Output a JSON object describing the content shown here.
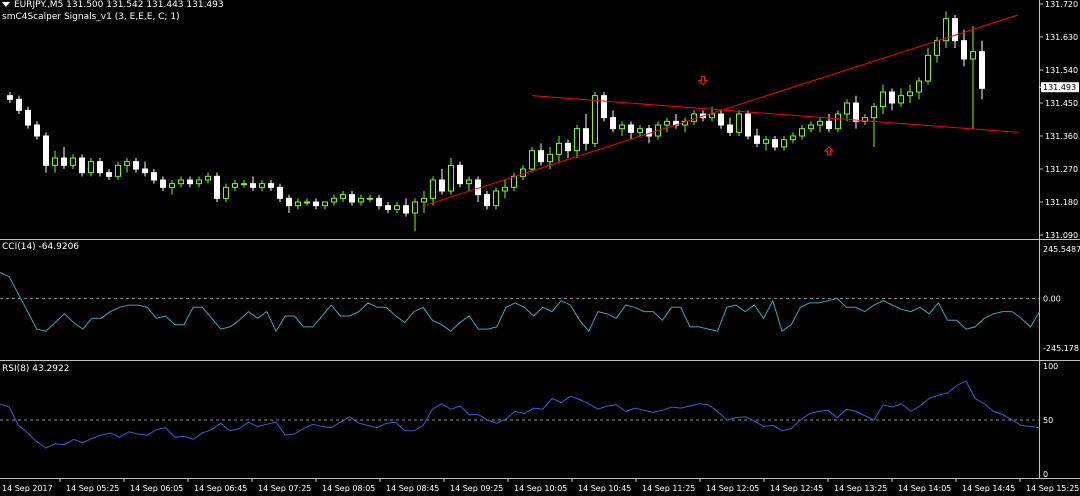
{
  "header": {
    "symbol_line": "EURJPY.,M5  131.500 131.542 131.443 131.493",
    "indicator_line": "smC4Scalper Signals_v1 (3, E,E,E, C; 1)"
  },
  "cci_panel": {
    "label": "CCI(14) -64.9206",
    "ticks": [
      "245.5487",
      "0.00",
      "-245.178"
    ]
  },
  "rsi_panel": {
    "label": "RSI(8) 43.2922",
    "ticks": [
      "100",
      "50",
      "0"
    ]
  },
  "price_axis": {
    "ticks": [
      "131.720",
      "131.630",
      "131.540",
      "131.450",
      "131.360",
      "131.270",
      "131.180",
      "131.090"
    ],
    "current_price_label": "131.493"
  },
  "time_axis": {
    "labels": [
      "14 Sep 2017",
      "14 Sep 05:25",
      "14 Sep 06:05",
      "14 Sep 06:45",
      "14 Sep 07:25",
      "14 Sep 08:05",
      "14 Sep 08:45",
      "14 Sep 09:25",
      "14 Sep 10:05",
      "14 Sep 10:45",
      "14 Sep 11:25",
      "14 Sep 12:05",
      "14 Sep 12:45",
      "14 Sep 13:25",
      "14 Sep 14:05",
      "14 Sep 14:45",
      "14 Sep 15:25"
    ]
  },
  "colors": {
    "background": "#000000",
    "bull": "#7cfc00",
    "bear": "#ffffff",
    "candle_body": "#ffffff",
    "trendline": "#ff0000",
    "arrow": "#ff2020",
    "cci": "#3aa7b5",
    "rsi": "#3a5bd9",
    "axis_text": "#ffffff",
    "separator": "#c0c0c0",
    "current_price_bg": "#ffffff"
  },
  "chart_data": [
    {
      "type": "candlestick",
      "title": "EURJPY.,M5",
      "ylim": [
        131.09,
        131.72
      ],
      "candles": [
        [
          131.47,
          131.48,
          131.45,
          131.46
        ],
        [
          131.46,
          131.47,
          131.42,
          131.43
        ],
        [
          131.43,
          131.44,
          131.38,
          131.39
        ],
        [
          131.39,
          131.4,
          131.35,
          131.36
        ],
        [
          131.36,
          131.37,
          131.26,
          131.28
        ],
        [
          131.28,
          131.32,
          131.26,
          131.3
        ],
        [
          131.3,
          131.33,
          131.27,
          131.28
        ],
        [
          131.28,
          131.31,
          131.27,
          131.3
        ],
        [
          131.3,
          131.31,
          131.25,
          131.26
        ],
        [
          131.26,
          131.3,
          131.25,
          131.29
        ],
        [
          131.29,
          131.3,
          131.25,
          131.26
        ],
        [
          131.26,
          131.27,
          131.24,
          131.25
        ],
        [
          131.25,
          131.29,
          131.24,
          131.28
        ],
        [
          131.28,
          131.3,
          131.26,
          131.29
        ],
        [
          131.29,
          131.3,
          131.26,
          131.27
        ],
        [
          131.27,
          131.29,
          131.25,
          131.26
        ],
        [
          131.26,
          131.27,
          131.23,
          131.24
        ],
        [
          131.24,
          131.25,
          131.21,
          131.22
        ],
        [
          131.22,
          131.24,
          131.2,
          131.23
        ],
        [
          131.23,
          131.25,
          131.22,
          131.24
        ],
        [
          131.24,
          131.25,
          131.22,
          131.23
        ],
        [
          131.23,
          131.25,
          131.22,
          131.24
        ],
        [
          131.24,
          131.26,
          131.23,
          131.25
        ],
        [
          131.25,
          131.26,
          131.18,
          131.19
        ],
        [
          131.19,
          131.23,
          131.18,
          131.22
        ],
        [
          131.22,
          131.24,
          131.21,
          131.23
        ],
        [
          131.23,
          131.24,
          131.22,
          131.23
        ],
        [
          131.23,
          131.25,
          131.21,
          131.22
        ],
        [
          131.22,
          131.24,
          131.21,
          131.23
        ],
        [
          131.23,
          131.24,
          131.21,
          131.22
        ],
        [
          131.22,
          131.23,
          131.18,
          131.19
        ],
        [
          131.19,
          131.2,
          131.15,
          131.17
        ],
        [
          131.17,
          131.19,
          131.16,
          131.18
        ],
        [
          131.18,
          131.19,
          131.17,
          131.18
        ],
        [
          131.18,
          131.19,
          131.16,
          131.17
        ],
        [
          131.17,
          131.18,
          131.16,
          131.18
        ],
        [
          131.18,
          131.2,
          131.17,
          131.19
        ],
        [
          131.19,
          131.21,
          131.18,
          131.2
        ],
        [
          131.2,
          131.21,
          131.17,
          131.18
        ],
        [
          131.18,
          131.2,
          131.17,
          131.19
        ],
        [
          131.19,
          131.2,
          131.18,
          131.19
        ],
        [
          131.19,
          131.2,
          131.16,
          131.17
        ],
        [
          131.17,
          131.18,
          131.15,
          131.16
        ],
        [
          131.16,
          131.18,
          131.15,
          131.17
        ],
        [
          131.17,
          131.19,
          131.14,
          131.15
        ],
        [
          131.15,
          131.19,
          131.1,
          131.18
        ],
        [
          131.18,
          131.21,
          131.15,
          131.19
        ],
        [
          131.19,
          131.25,
          131.17,
          131.24
        ],
        [
          131.24,
          131.27,
          131.2,
          131.21
        ],
        [
          131.21,
          131.3,
          131.2,
          131.28
        ],
        [
          131.28,
          131.29,
          131.22,
          131.23
        ],
        [
          131.23,
          131.25,
          131.21,
          131.24
        ],
        [
          131.24,
          131.25,
          131.18,
          131.2
        ],
        [
          131.2,
          131.21,
          131.16,
          131.17
        ],
        [
          131.17,
          131.22,
          131.16,
          131.21
        ],
        [
          131.21,
          131.24,
          131.19,
          131.22
        ],
        [
          131.22,
          131.26,
          131.21,
          131.25
        ],
        [
          131.25,
          131.28,
          131.24,
          131.27
        ],
        [
          131.27,
          131.33,
          131.26,
          131.32
        ],
        [
          131.32,
          131.34,
          131.28,
          131.29
        ],
        [
          131.29,
          131.33,
          131.27,
          131.31
        ],
        [
          131.31,
          131.36,
          131.29,
          131.34
        ],
        [
          131.34,
          131.35,
          131.3,
          131.32
        ],
        [
          131.32,
          131.39,
          131.3,
          131.38
        ],
        [
          131.38,
          131.42,
          131.32,
          131.34
        ],
        [
          131.34,
          131.48,
          131.33,
          131.47
        ],
        [
          131.47,
          131.48,
          131.4,
          131.41
        ],
        [
          131.41,
          131.43,
          131.37,
          131.38
        ],
        [
          131.38,
          131.4,
          131.36,
          131.39
        ],
        [
          131.39,
          131.4,
          131.35,
          131.37
        ],
        [
          131.37,
          131.39,
          131.36,
          131.38
        ],
        [
          131.38,
          131.39,
          131.34,
          131.36
        ],
        [
          131.36,
          131.4,
          131.35,
          131.39
        ],
        [
          131.39,
          131.41,
          131.37,
          131.4
        ],
        [
          131.4,
          131.42,
          131.38,
          131.39
        ],
        [
          131.39,
          131.41,
          131.37,
          131.4
        ],
        [
          131.4,
          131.43,
          131.39,
          131.42
        ],
        [
          131.42,
          131.43,
          131.4,
          131.41
        ],
        [
          131.41,
          131.44,
          131.4,
          131.42
        ],
        [
          131.42,
          131.43,
          131.38,
          131.39
        ],
        [
          131.39,
          131.41,
          131.36,
          131.37
        ],
        [
          131.37,
          131.43,
          131.36,
          131.42
        ],
        [
          131.42,
          131.43,
          131.35,
          131.36
        ],
        [
          131.36,
          131.38,
          131.33,
          131.34
        ],
        [
          131.34,
          131.36,
          131.32,
          131.35
        ],
        [
          131.35,
          131.36,
          131.32,
          131.33
        ],
        [
          131.33,
          131.36,
          131.32,
          131.35
        ],
        [
          131.35,
          131.37,
          131.34,
          131.36
        ],
        [
          131.36,
          131.39,
          131.35,
          131.38
        ],
        [
          131.38,
          131.4,
          131.37,
          131.39
        ],
        [
          131.39,
          131.41,
          131.37,
          131.4
        ],
        [
          131.4,
          131.42,
          131.37,
          131.38
        ],
        [
          131.38,
          131.43,
          131.37,
          131.42
        ],
        [
          131.42,
          131.46,
          131.4,
          131.45
        ],
        [
          131.45,
          131.47,
          131.38,
          131.4
        ],
        [
          131.4,
          131.42,
          131.39,
          131.41
        ],
        [
          131.41,
          131.45,
          131.33,
          131.44
        ],
        [
          131.44,
          131.5,
          131.42,
          131.48
        ],
        [
          131.48,
          131.49,
          131.43,
          131.45
        ],
        [
          131.45,
          131.49,
          131.44,
          131.47
        ],
        [
          131.47,
          131.5,
          131.45,
          131.48
        ],
        [
          131.48,
          131.52,
          131.46,
          131.51
        ],
        [
          131.51,
          131.6,
          131.5,
          131.58
        ],
        [
          131.58,
          131.63,
          131.56,
          131.62
        ],
        [
          131.62,
          131.7,
          131.6,
          131.68
        ],
        [
          131.68,
          131.69,
          131.6,
          131.62
        ],
        [
          131.62,
          131.65,
          131.55,
          131.57
        ],
        [
          131.57,
          131.66,
          131.38,
          131.59
        ],
        [
          131.59,
          131.62,
          131.46,
          131.49
        ]
      ],
      "trendlines": [
        {
          "from": [
            131.47,
            58
          ],
          "to": [
            131.37,
            112
          ]
        },
        {
          "from": [
            131.17,
            46
          ],
          "to": [
            131.69,
            112
          ]
        }
      ],
      "signals": [
        {
          "type": "down",
          "index": 77,
          "price": 131.5
        },
        {
          "type": "up",
          "index": 91,
          "price": 131.33
        }
      ],
      "current_price": 131.493
    },
    {
      "type": "line",
      "title": "CCI(14) -64.9206",
      "ylim": [
        -245.178,
        245.5487
      ],
      "series": [
        {
          "name": "CCI(14)",
          "values": [
            120,
            100,
            20,
            -60,
            -140,
            -150,
            -110,
            -70,
            -110,
            -140,
            -90,
            -90,
            -60,
            -40,
            -30,
            -30,
            -40,
            -90,
            -80,
            -120,
            -120,
            -40,
            -40,
            -90,
            -140,
            -130,
            -100,
            -60,
            -90,
            -60,
            -150,
            -80,
            -80,
            -130,
            -130,
            -80,
            -30,
            -80,
            -80,
            -60,
            -20,
            -40,
            -40,
            -80,
            -110,
            -60,
            -40,
            -100,
            -120,
            -150,
            -110,
            -80,
            -140,
            -140,
            -130,
            -40,
            -20,
            -40,
            -80,
            -40,
            -60,
            -10,
            -30,
            -100,
            -150,
            -60,
            -70,
            -90,
            -30,
            -40,
            -60,
            -60,
            -100,
            -40,
            -40,
            -130,
            -130,
            -140,
            -150,
            -40,
            -30,
            -60,
            -30,
            -90,
            -10,
            -150,
            -120,
            -40,
            -20,
            -20,
            -10,
            0,
            -40,
            -40,
            -60,
            -30,
            -10,
            -30,
            -50,
            -60,
            -40,
            -70,
            -20,
            -100,
            -100,
            -140,
            -130,
            -90,
            -70,
            -60,
            -60,
            -90,
            -130,
            -60
          ]
        }
      ]
    },
    {
      "type": "line",
      "title": "RSI(8) 43.2922",
      "ylim": [
        0,
        100
      ],
      "series": [
        {
          "name": "RSI(8)",
          "values": [
            65,
            62,
            45,
            38,
            30,
            24,
            28,
            27,
            32,
            29,
            33,
            36,
            38,
            34,
            39,
            37,
            36,
            41,
            43,
            34,
            35,
            32,
            38,
            41,
            47,
            40,
            42,
            48,
            44,
            46,
            48,
            36,
            37,
            42,
            46,
            44,
            43,
            48,
            53,
            47,
            45,
            43,
            47,
            48,
            40,
            40,
            45,
            60,
            65,
            60,
            63,
            55,
            55,
            50,
            47,
            51,
            58,
            56,
            61,
            60,
            70,
            66,
            72,
            69,
            65,
            60,
            63,
            64,
            58,
            61,
            59,
            57,
            59,
            62,
            61,
            63,
            65,
            64,
            58,
            50,
            52,
            53,
            49,
            44,
            45,
            40,
            42,
            50,
            56,
            58,
            59,
            52,
            60,
            58,
            54,
            50,
            64,
            62,
            65,
            58,
            63,
            70,
            73,
            75,
            82,
            86,
            70,
            65,
            58,
            55,
            50,
            45,
            44,
            43
          ]
        }
      ]
    }
  ]
}
